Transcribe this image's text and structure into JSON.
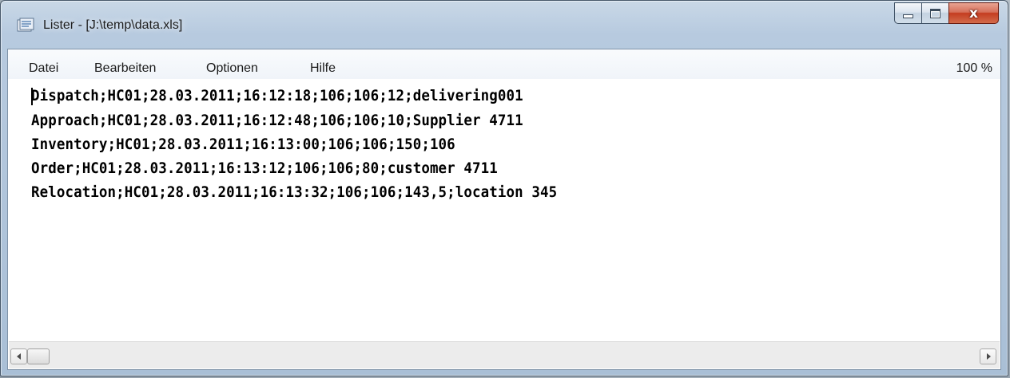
{
  "window": {
    "title": "Lister - [J:\\temp\\data.xls]",
    "close_symbol": "x"
  },
  "menu": {
    "items": [
      "Datei",
      "Bearbeiten",
      "Optionen",
      "Hilfe"
    ],
    "zoom": "100 %"
  },
  "content": {
    "lines": [
      "Dispatch;HC01;28.03.2011;16:12:18;106;106;12;delivering001",
      "Approach;HC01;28.03.2011;16:12:48;106;106;10;Supplier 4711",
      "Inventory;HC01;28.03.2011;16:13:00;106;106;150;106",
      "Order;HC01;28.03.2011;16:13:12;106;106;80;customer 4711",
      "Relocation;HC01;28.03.2011;16:13:32;106;106;143,5;location 345"
    ]
  },
  "icons": {
    "app": "lister-app-icon",
    "minimize": "minimize-icon",
    "maximize": "maximize-icon",
    "close": "close-icon",
    "scroll_left": "scroll-left-arrow-icon",
    "scroll_right": "scroll-right-arrow-icon"
  }
}
